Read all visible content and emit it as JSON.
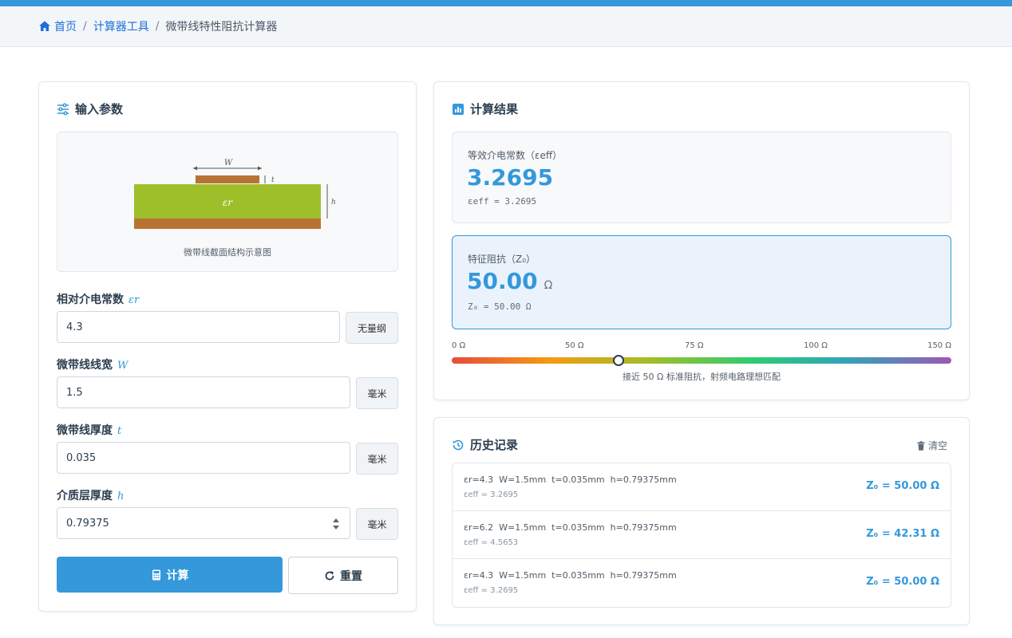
{
  "breadcrumb": {
    "home": "首页",
    "tools": "计算器工具",
    "current": "微带线特性阻抗计算器"
  },
  "input_panel": {
    "title": "输入参数",
    "diagram": {
      "caption": "微带线截面结构示意图",
      "label_w": "W",
      "label_t": "t",
      "label_h": "h",
      "label_er": "εr"
    },
    "fields": [
      {
        "label": "相对介电常数",
        "symbol": "εr",
        "value": "4.3",
        "unit": "无量纲"
      },
      {
        "label": "微带线线宽",
        "symbol": "W",
        "value": "1.5",
        "unit": "毫米"
      },
      {
        "label": "微带线厚度",
        "symbol": "t",
        "value": "0.035",
        "unit": "毫米"
      },
      {
        "label": "介质层厚度",
        "symbol": "h",
        "value": "0.79375",
        "unit": "毫米"
      }
    ],
    "calc_button": "计算",
    "reset_button": "重置"
  },
  "result_panel": {
    "title": "计算结果",
    "eeff": {
      "label": "等效介电常数（εeff）",
      "value": "3.2695",
      "formula": "εeff = 3.2695"
    },
    "z0": {
      "label": "特征阻抗（Z₀）",
      "value": "50.00",
      "unit": "Ω",
      "formula": "Z₀ = 50.00 Ω"
    },
    "scale": {
      "labels": [
        "0 Ω",
        "50 Ω",
        "75 Ω",
        "100 Ω",
        "150 Ω"
      ],
      "marker_value": 50,
      "range": [
        0,
        150
      ],
      "note": "接近 50 Ω 标准阻抗，射频电路理想匹配"
    }
  },
  "history_panel": {
    "title": "历史记录",
    "clear_label": "清空",
    "items": [
      {
        "params": "εr=4.3  W=1.5mm  t=0.035mm  h=0.79375mm",
        "eeff": "εeff = 3.2695",
        "z0": "Z₀ = 50.00 Ω"
      },
      {
        "params": "εr=6.2  W=1.5mm  t=0.035mm  h=0.79375mm",
        "eeff": "εeff = 4.5653",
        "z0": "Z₀ = 42.31 Ω"
      },
      {
        "params": "εr=4.3  W=1.5mm  t=0.035mm  h=0.79375mm",
        "eeff": "εeff = 3.2695",
        "z0": "Z₀ = 50.00 Ω"
      }
    ]
  },
  "colors": {
    "accent": "#3498db",
    "link": "#1e6fd9",
    "substrate": "#9fbf2a",
    "copper": "#b87333"
  }
}
